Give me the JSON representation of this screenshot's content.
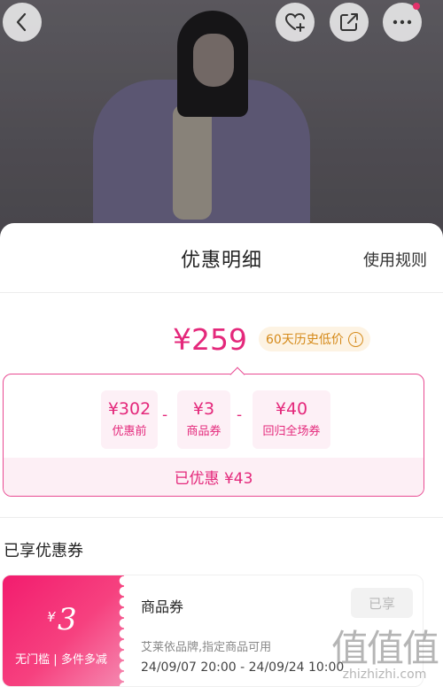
{
  "sheet": {
    "title": "优惠明细",
    "rules_link": "使用规则"
  },
  "price": {
    "final": "¥259",
    "history_badge": "60天历史低价"
  },
  "calculation": {
    "items": [
      {
        "amount": "¥302",
        "label": "优惠前"
      },
      {
        "amount": "¥3",
        "label": "商品券"
      },
      {
        "amount": "¥40",
        "label": "回归全场券"
      }
    ],
    "operator": "-",
    "saved": "已优惠 ¥43"
  },
  "coupons_section": {
    "title": "已享优惠券",
    "coupon": {
      "currency": "¥",
      "amount": "3",
      "condition": "无门槛 | 多件多减",
      "name": "商品券",
      "status": "已享",
      "description": "艾莱依品牌,指定商品可用",
      "validity": "24/09/07 20:00 - 24/09/24 10:00"
    }
  },
  "watermark": {
    "logo": "值值值",
    "url": "zhizhizhi.com"
  },
  "icons": [
    "back-arrow-icon",
    "favorite-add-icon",
    "share-icon",
    "more-icon",
    "info-icon"
  ],
  "colors": {
    "accent": "#e4287b",
    "badge_text": "#d58a1a",
    "badge_bg": "#fdf3e3"
  }
}
